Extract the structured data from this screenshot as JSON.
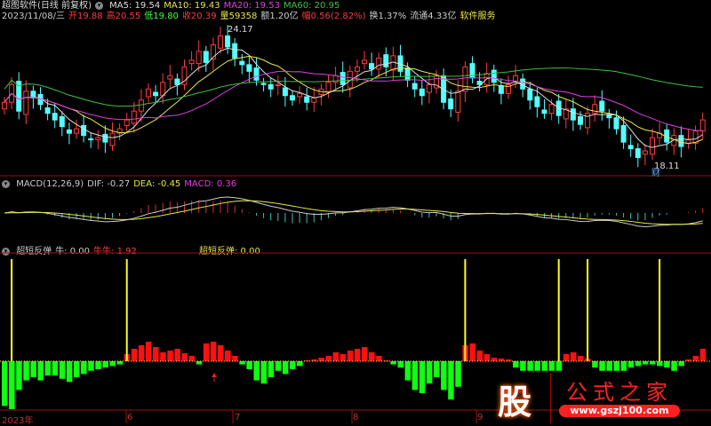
{
  "header": {
    "title": "超图软件(日线 前复权)",
    "ma5": "MA5: 19.54",
    "ma10": "MA10: 19.43",
    "ma20": "MA20: 19.53",
    "ma60": "MA60: 20.95",
    "date": "2023/11/08/三",
    "open": "开19.88",
    "high": "高20.55",
    "low": "低19.80",
    "close": "收20.39",
    "vol": "量59358",
    "amount": "额1.20亿",
    "change": "幅0.56(2.82%)",
    "turnover": "换1.37%",
    "float": "流通4.33亿",
    "sector": "软件服务"
  },
  "main": {
    "high_label": "24.17",
    "low_label": "18.11",
    "marker": "财"
  },
  "macd": {
    "title": "MACD(12,26,9)",
    "dif": "DIF: -0.27",
    "dea": "DEA: -0.45",
    "macd": "MACD: 0.36"
  },
  "osc": {
    "title": "超短反弹",
    "niu": "牛: 0.00",
    "niuniu": "牛牛: 1.92",
    "rebound": "超短反弹: 0.00"
  },
  "axis": [
    "2023年",
    "6",
    "7",
    "8",
    "9"
  ],
  "watermark": {
    "char": "股",
    "name": "公式之家",
    "url": "www.gszj100.com"
  },
  "colors": {
    "up": "#ff3b3b",
    "down": "#54ffff",
    "ma5": "#dddddd",
    "ma10": "#e6e64a",
    "ma20": "#e040e0",
    "ma60": "#40c040"
  },
  "chart_data": {
    "type": "candlestick",
    "closes": [
      21.0,
      21.8,
      20.6,
      21.5,
      21.2,
      20.9,
      20.5,
      20.2,
      19.9,
      19.6,
      19.8,
      19.5,
      19.3,
      19.4,
      19.2,
      19.6,
      19.8,
      20.2,
      20.6,
      21.1,
      21.6,
      21.3,
      21.9,
      22.2,
      21.8,
      22.6,
      22.9,
      23.3,
      22.8,
      23.6,
      24.0,
      23.5,
      23.0,
      22.7,
      22.4,
      22.0,
      21.8,
      21.6,
      21.8,
      21.3,
      21.1,
      21.4,
      21.0,
      21.2,
      21.6,
      21.9,
      22.2,
      21.8,
      22.4,
      22.6,
      22.9,
      22.5,
      23.0,
      22.6,
      23.1,
      22.4,
      22.0,
      21.6,
      21.3,
      21.8,
      22.2,
      21.0,
      20.7,
      21.5,
      22.6,
      22.1,
      21.8,
      22.3,
      21.9,
      21.4,
      21.8,
      22.2,
      21.6,
      21.1,
      20.8,
      20.5,
      20.9,
      20.4,
      20.7,
      20.2,
      20.0,
      20.5,
      20.9,
      20.6,
      20.3,
      19.8,
      19.2,
      18.9,
      18.5,
      18.8,
      19.4,
      19.6,
      19.2,
      19.5,
      19.0,
      19.3,
      19.7,
      20.2
    ],
    "osc": [
      -28,
      -30,
      -18,
      -12,
      -10,
      -12,
      -9,
      -9,
      -11,
      -13,
      -10,
      -8,
      -6,
      -5,
      -4,
      -3,
      -2,
      8,
      14,
      18,
      22,
      16,
      10,
      12,
      14,
      9,
      6,
      -2,
      20,
      22,
      18,
      12,
      6,
      -2,
      -5,
      -12,
      -14,
      -10,
      -6,
      -8,
      -5,
      -3,
      1,
      2,
      4,
      6,
      10,
      8,
      12,
      14,
      16,
      10,
      6,
      1,
      -2,
      -4,
      -12,
      -18,
      -20,
      -14,
      -10,
      -18,
      -24,
      -16,
      18,
      20,
      12,
      8,
      4,
      3,
      2,
      -4,
      -6,
      -6,
      -6,
      -6,
      -6,
      -6,
      8,
      10,
      6,
      3,
      -4,
      -6,
      -6,
      -6,
      -6,
      -4,
      -3,
      -2,
      -2,
      -3,
      -4,
      -6,
      -3,
      2,
      6,
      14
    ],
    "spikes": [
      1,
      17,
      64,
      77,
      81,
      91
    ],
    "price_range": [
      17.8,
      24.5
    ]
  }
}
